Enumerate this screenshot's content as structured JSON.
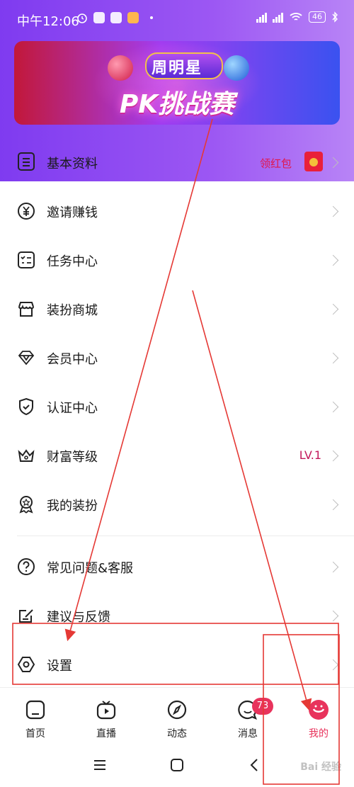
{
  "status_bar": {
    "time": "中午12:06",
    "battery": "46"
  },
  "banner": {
    "title": "周明星",
    "subtitle": "PK挑战赛"
  },
  "profile": {
    "label": "基本资料",
    "red_packet": "领红包"
  },
  "menu": [
    {
      "label": "邀请赚钱",
      "icon": "yen-icon",
      "value": ""
    },
    {
      "label": "任务中心",
      "icon": "checklist-icon",
      "value": ""
    },
    {
      "label": "装扮商城",
      "icon": "store-icon",
      "value": ""
    },
    {
      "label": "会员中心",
      "icon": "diamond-icon",
      "value": ""
    },
    {
      "label": "认证中心",
      "icon": "shield-check-icon",
      "value": ""
    },
    {
      "label": "财富等级",
      "icon": "crown-icon",
      "value": "LV.1"
    },
    {
      "label": "我的装扮",
      "icon": "medal-icon",
      "value": ""
    },
    {
      "label": "常见问题&客服",
      "icon": "question-icon",
      "value": ""
    },
    {
      "label": "建议与反馈",
      "icon": "feedback-edit-icon",
      "value": ""
    },
    {
      "label": "设置",
      "icon": "settings-hex-icon",
      "value": ""
    }
  ],
  "bottom_nav": [
    {
      "label": "首页",
      "icon": "home-icon",
      "active": false
    },
    {
      "label": "直播",
      "icon": "tv-icon",
      "active": false
    },
    {
      "label": "动态",
      "icon": "compass-icon",
      "active": false
    },
    {
      "label": "消息",
      "icon": "chat-icon",
      "active": false,
      "badge": "73"
    },
    {
      "label": "我的",
      "icon": "profile-face-icon",
      "active": true
    }
  ],
  "watermark": "Bai 经验",
  "colors": {
    "accent": "#8b47f2",
    "active_pink": "#e8335c",
    "annotation_red": "#e53935",
    "level_text": "#c2185b"
  }
}
